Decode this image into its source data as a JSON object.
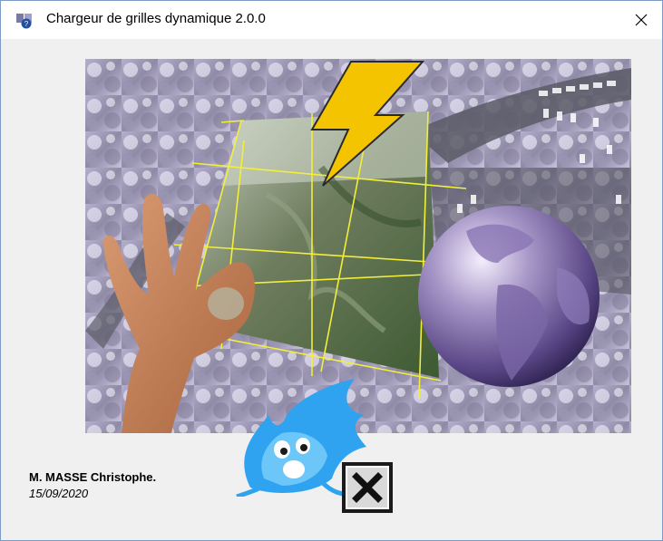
{
  "window": {
    "title": "Chargeur de grilles dynamique 2.0.0",
    "close_glyph": "✕"
  },
  "icons": {
    "app": "app-icon",
    "close": "close-icon",
    "close_image": "close-x-box-icon",
    "lightning": "lightning-bolt-icon",
    "globe": "globe-icon",
    "hand": "ok-hand-icon",
    "flame": "blue-flame-mascot-icon"
  },
  "author": {
    "name": "M. MASSE Christophe.",
    "date": "15/09/2020"
  },
  "colors": {
    "titlebar": "#ffffff",
    "window_bg": "#f0f0f0",
    "border": "#7a9cc6",
    "grid_lines": "#f2ee3a",
    "lightning": "#f5c400",
    "globe": "#7e6aa6"
  }
}
